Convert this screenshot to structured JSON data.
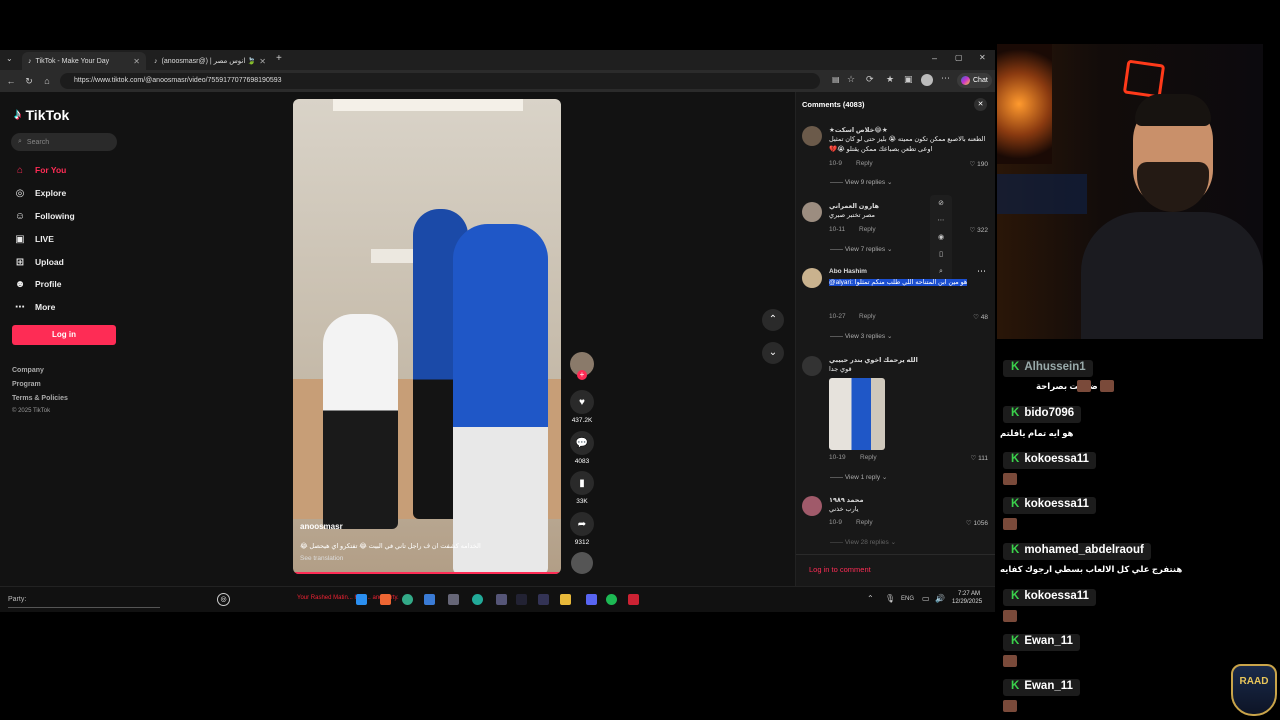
{
  "browser": {
    "tabs": [
      {
        "title": "TikTok - Make Your Day",
        "active": true
      },
      {
        "title": "(anoosmasr@) | انوس مصر 🍃 ...",
        "active": false
      }
    ],
    "url": "https://www.tiktok.com/@anoosmasr/video/7559177077698190593",
    "chat_label": "Chat"
  },
  "sidebar": {
    "logo": "TikTok",
    "search_placeholder": "Search",
    "items": [
      {
        "label": "For You",
        "icon": "home-icon",
        "active": true
      },
      {
        "label": "Explore",
        "icon": "compass-icon"
      },
      {
        "label": "Following",
        "icon": "following-icon"
      },
      {
        "label": "LIVE",
        "icon": "live-icon"
      },
      {
        "label": "Upload",
        "icon": "upload-icon"
      },
      {
        "label": "Profile",
        "icon": "profile-icon"
      },
      {
        "label": "More",
        "icon": "more-icon"
      }
    ],
    "login": "Log in",
    "footer": [
      "Company",
      "Program",
      "Terms & Policies",
      "© 2025 TikTok"
    ]
  },
  "video": {
    "author": "anoosmasr",
    "caption": "الخدامه كشفت ان ف راجل تاني في البيت 😂 تفتكرو اي هيحصل 😂",
    "see_translation": "See translation",
    "likes": "437.2K",
    "comments": "4083",
    "saves": "33K",
    "shares": "9312"
  },
  "comments": {
    "title": "Comments (4083)",
    "login_prompt": "Log in to comment",
    "items": [
      {
        "name": "★خلاص اسكت😂★",
        "text": "الطعنه بالاصبع ممكن تكون مميته 😭 بليز حتى لو كان تمثيل اوعى تطعن بصباعك ممكن يقتلو 😭💔",
        "date": "10-9",
        "reply": "Reply",
        "likes": "190",
        "replies": "View 9 replies"
      },
      {
        "name": "هارون العمراني",
        "text": "مصر تختبر صبري",
        "date": "10-11",
        "reply": "Reply",
        "likes": "322",
        "replies": "View 7 replies"
      },
      {
        "name": "Abo Hashim",
        "text": "@alyari: هو مين ابن المتناحه اللي طلب منكم تمثلوا",
        "date": "10-27",
        "reply": "Reply",
        "likes": "48",
        "replies": "View 3 replies"
      },
      {
        "name": "الله يرحمك اخوي بندر حبيبي",
        "text": "قوي جدا",
        "date": "10-19",
        "reply": "Reply",
        "likes": "111",
        "replies": "View 1 reply"
      },
      {
        "name": "محمد ١٩٨٩",
        "text": "يارب خذني",
        "date": "10-9",
        "reply": "Reply",
        "likes": "1056",
        "replies": "View 28 replies"
      }
    ]
  },
  "taskbar": {
    "party": "Party:",
    "ticker": "Your Rashed Matin... has ... and party.",
    "lang": "ENG",
    "time": "7:27 AM",
    "date": "12/29/2025"
  },
  "chat": [
    {
      "user": "Alhussein1",
      "message": "انا ضحكت بصراحة"
    },
    {
      "user": "bido7096",
      "message": "هو ايه تمام يافلتم"
    },
    {
      "user": "kokoessa11",
      "message": ""
    },
    {
      "user": "kokoessa11",
      "message": ""
    },
    {
      "user": "mohamed_abdelraouf",
      "message": "هنتفرج علي كل الالعاب بسطي ارجوك كفايه"
    },
    {
      "user": "kokoessa11",
      "message": ""
    },
    {
      "user": "Ewan_11",
      "message": ""
    },
    {
      "user": "Ewan_11",
      "message": ""
    }
  ],
  "overlay": {
    "badge": "RAAD"
  },
  "colors": {
    "accent": "#fe2c55",
    "chat_green": "#3ad14b",
    "highlight": "#1b4fd1"
  }
}
